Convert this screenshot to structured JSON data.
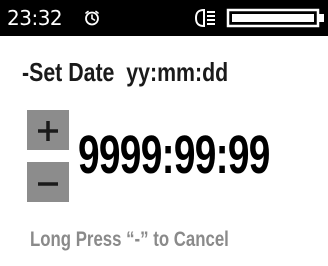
{
  "status_bar": {
    "time": "23:32",
    "icons": [
      "alarm-icon",
      "headlight-icon",
      "battery-icon"
    ]
  },
  "screen": {
    "title": "-Set Date  yy:mm:dd",
    "date_value": "9999:99:99",
    "hint": "Long Press “-” to Cancel"
  },
  "controls": {
    "increment_icon": "plus-icon",
    "decrement_icon": "minus-icon"
  },
  "colors": {
    "status_bar_bg": "#000000",
    "button_bg": "#8c8c8c",
    "hint_text": "#8a8a8a",
    "value_text": "#000000"
  }
}
